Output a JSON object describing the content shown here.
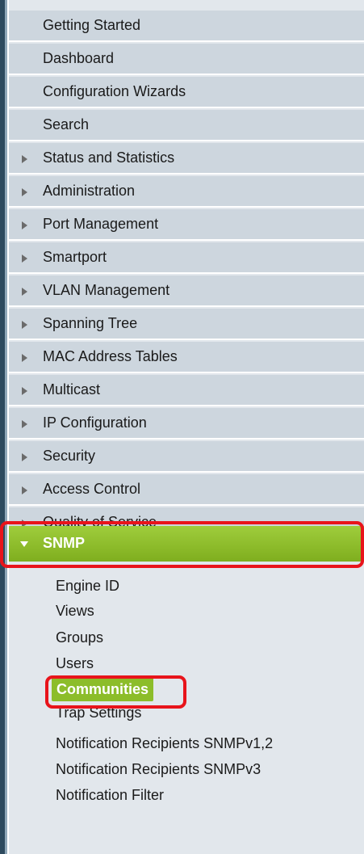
{
  "menu": {
    "items": [
      {
        "label": "Getting Started",
        "arrow": false
      },
      {
        "label": "Dashboard",
        "arrow": false
      },
      {
        "label": "Configuration Wizards",
        "arrow": false
      },
      {
        "label": "Search",
        "arrow": false
      },
      {
        "label": "Status and Statistics",
        "arrow": true
      },
      {
        "label": "Administration",
        "arrow": true
      },
      {
        "label": "Port Management",
        "arrow": true
      },
      {
        "label": "Smartport",
        "arrow": true
      },
      {
        "label": "VLAN Management",
        "arrow": true
      },
      {
        "label": "Spanning Tree",
        "arrow": true
      },
      {
        "label": "MAC Address Tables",
        "arrow": true
      },
      {
        "label": "Multicast",
        "arrow": true
      },
      {
        "label": "IP Configuration",
        "arrow": true
      },
      {
        "label": "Security",
        "arrow": true
      },
      {
        "label": "Access Control",
        "arrow": true
      },
      {
        "label": "Quality of Service",
        "arrow": true
      }
    ],
    "active": {
      "label": "SNMP",
      "expanded": true
    },
    "submenu": [
      {
        "label": "Engine ID",
        "selected": false
      },
      {
        "label": "Views",
        "selected": false
      },
      {
        "label": "Groups",
        "selected": false
      },
      {
        "label": "Users",
        "selected": false
      },
      {
        "label": "Communities",
        "selected": true
      },
      {
        "label": "Trap Settings",
        "selected": false
      },
      {
        "label": "Notification Recipients SNMPv1,2",
        "selected": false
      },
      {
        "label": "Notification Recipients SNMPv3",
        "selected": false
      },
      {
        "label": "Notification Filter",
        "selected": false
      }
    ]
  },
  "colors": {
    "active_green": "#8cbd2a",
    "highlight_red": "#e8141b",
    "item_bg": "#cdd6de"
  }
}
